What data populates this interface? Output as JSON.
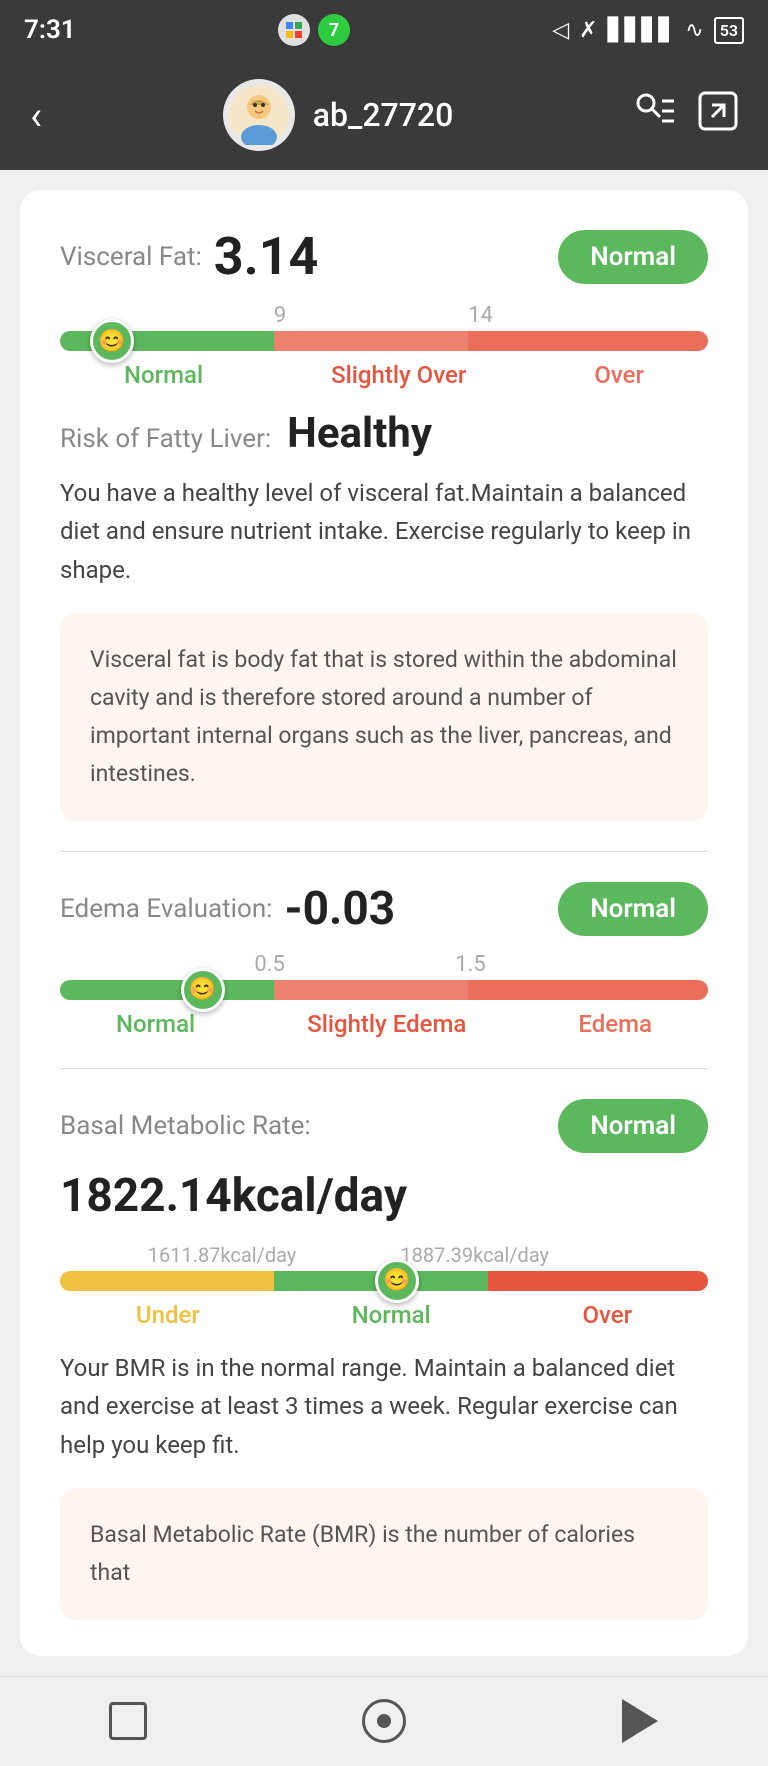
{
  "statusBar": {
    "time": "7:31",
    "battery": "53"
  },
  "header": {
    "username": "ab_27720",
    "backLabel": "‹"
  },
  "visceralFat": {
    "label": "Visceral Fat:",
    "value": "3.14",
    "badge": "Normal",
    "marker1": "9",
    "marker2": "14",
    "rangeNormal": "Normal",
    "rangeSlightlyOver": "Slightly Over",
    "rangeOver": "Over",
    "fattyLiverLabel": "Risk of Fatty Liver:",
    "fattyLiverValue": "Healthy",
    "description": "You have a healthy level of visceral fat.Maintain a balanced diet and ensure nutrient intake. Exercise regularly to keep in shape.",
    "infoText": "Visceral fat is body fat that is stored within the abdominal cavity and is therefore stored around a number of important internal organs such as the liver, pancreas, and intestines."
  },
  "edema": {
    "label": "Edema Evaluation:",
    "value": "-0.03",
    "badge": "Normal",
    "marker1": "0.5",
    "marker2": "1.5",
    "rangeNormal": "Normal",
    "rangeSlightlyEdema": "Slightly Edema",
    "rangeEdema": "Edema"
  },
  "bmr": {
    "label": "Basal Metabolic Rate:",
    "badge": "Normal",
    "value": "1822.14kcal/day",
    "markerLow": "1611.87kcal/day",
    "markerHigh": "1887.39kcal/day",
    "rangeUnder": "Under",
    "rangeNormal": "Normal",
    "rangeOver": "Over",
    "description": "Your BMR is in the normal range. Maintain a balanced diet and exercise at least 3 times a week. Regular exercise can help you keep fit.",
    "infoText": "Basal Metabolic Rate (BMR) is the number of calories that"
  },
  "bottomNav": {
    "square": "square-button",
    "circle": "home-button",
    "back": "back-button"
  }
}
